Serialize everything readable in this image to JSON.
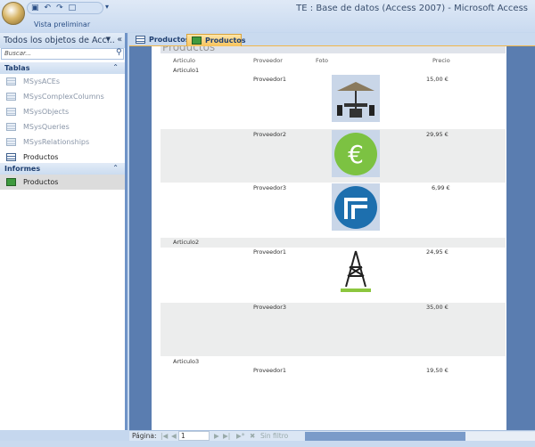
{
  "window": {
    "title": "TE : Base de datos (Access 2007) - Microsoft Access",
    "view_label": "Vista preliminar"
  },
  "nav": {
    "header": "Todos los objetos de Acc...",
    "search_placeholder": "Buscar...",
    "groups": [
      {
        "label": "Tablas",
        "items": [
          "MSysACEs",
          "MSysComplexColumns",
          "MSysObjects",
          "MSysQueries",
          "MSysRelationships",
          "Productos"
        ]
      },
      {
        "label": "Informes",
        "items": [
          "Productos"
        ]
      }
    ]
  },
  "tabs": [
    {
      "label": "Productos",
      "active": false
    },
    {
      "label": "Productos",
      "active": true
    }
  ],
  "report": {
    "title": "Productos",
    "columns": [
      "Articulo",
      "Proveedor",
      "Foto",
      "Precio"
    ],
    "groups": [
      {
        "articulo": "Articulo1",
        "rows": [
          {
            "proveedor": "Proveedor1",
            "foto": "umbrella-table",
            "precio": "15,00 €"
          },
          {
            "proveedor": "Proveedor2",
            "foto": "euro-icon",
            "precio": "29,95 €"
          },
          {
            "proveedor": "Proveedor3",
            "foto": "blue-logo",
            "precio": "6,99 €"
          }
        ]
      },
      {
        "articulo": "Articulo2",
        "rows": [
          {
            "proveedor": "Proveedor1",
            "foto": "tower-icon",
            "precio": "24,95 €"
          },
          {
            "proveedor": "Proveedor3",
            "foto": "",
            "precio": "35,00 €"
          }
        ]
      },
      {
        "articulo": "Articulo3",
        "rows": [
          {
            "proveedor": "Proveedor1",
            "foto": "",
            "precio": "19,50 €"
          }
        ]
      }
    ]
  },
  "status": {
    "page_label": "Página:",
    "page_value": "1",
    "filter_label": "Sin filtro"
  }
}
